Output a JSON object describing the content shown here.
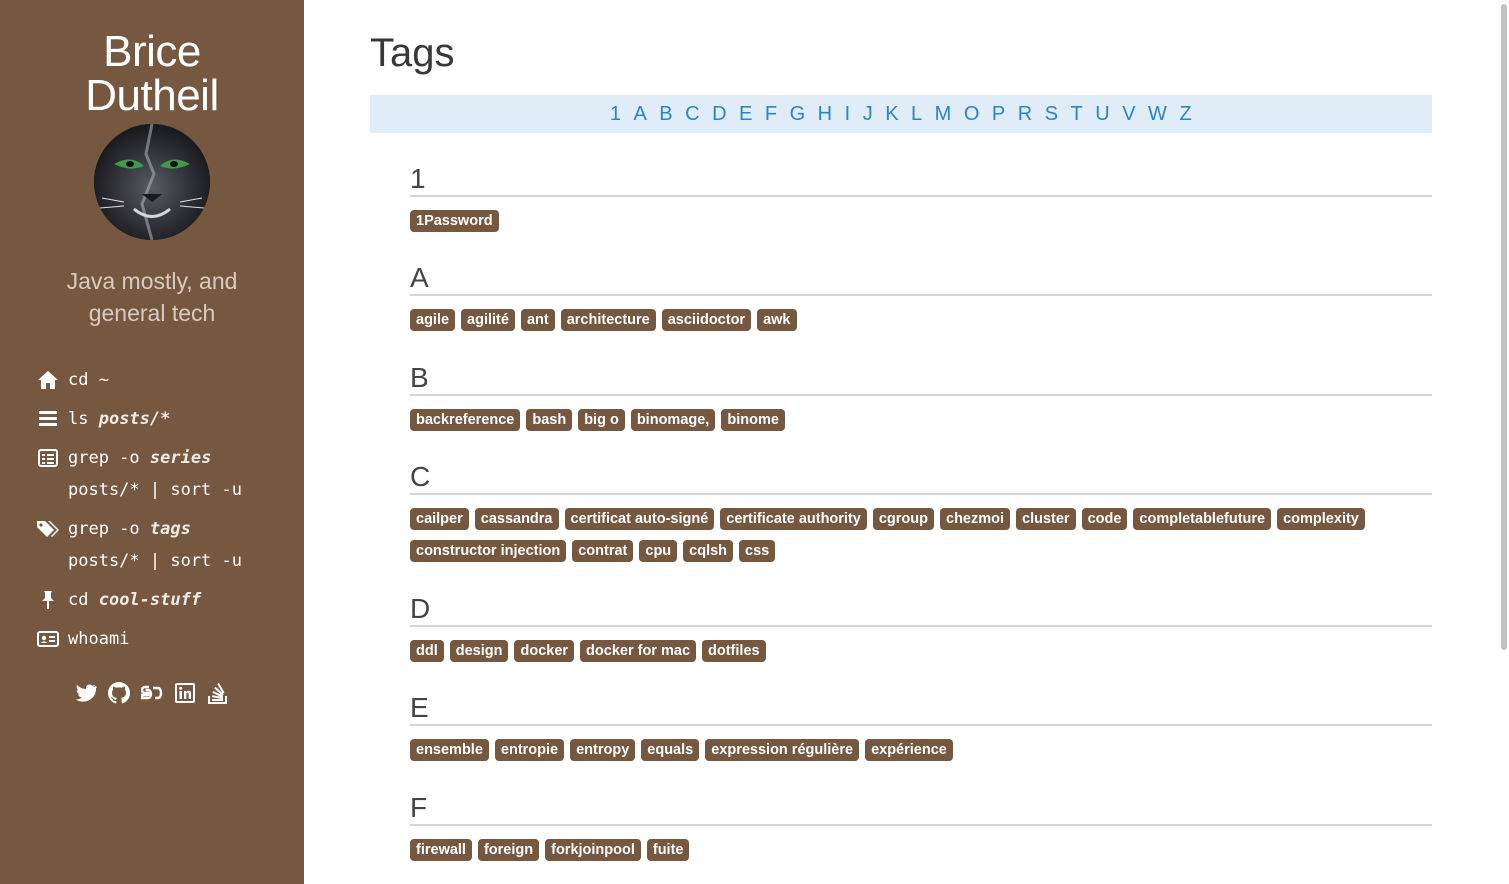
{
  "sidebar": {
    "title_line1": "Brice",
    "title_line2": "Dutheil",
    "tagline": "Java mostly, and general tech",
    "nav": [
      {
        "icon": "home-icon",
        "cmd": "cd ~ ",
        "arg": ""
      },
      {
        "icon": "list-icon",
        "cmd": "ls ",
        "arg": "posts/*"
      },
      {
        "icon": "list-alt-icon",
        "cmd": "grep -o ",
        "arg": "series",
        "line2": "posts/* | sort -u"
      },
      {
        "icon": "tags-icon",
        "cmd": "grep -o ",
        "arg": "tags",
        "line2": "posts/* | sort -u"
      },
      {
        "icon": "pin-icon",
        "cmd": "cd ",
        "arg": "cool-stuff"
      },
      {
        "icon": "id-card-icon",
        "cmd": "whoami",
        "arg": ""
      }
    ],
    "social": [
      "twitter-icon",
      "github-icon",
      "speakerdeck-icon",
      "linkedin-icon",
      "stackoverflow-icon"
    ]
  },
  "main": {
    "title": "Tags",
    "letters": [
      "1",
      "A",
      "B",
      "C",
      "D",
      "E",
      "F",
      "G",
      "H",
      "I",
      "J",
      "K",
      "L",
      "M",
      "O",
      "P",
      "R",
      "S",
      "T",
      "U",
      "V",
      "W",
      "Z"
    ],
    "sections": [
      {
        "letter": "1",
        "tags": [
          "1Password"
        ]
      },
      {
        "letter": "A",
        "tags": [
          "agile",
          "agilité",
          "ant",
          "architecture",
          "asciidoctor",
          "awk"
        ]
      },
      {
        "letter": "B",
        "tags": [
          "backreference",
          "bash",
          "big o",
          "binomage,",
          "binome"
        ]
      },
      {
        "letter": "C",
        "tags": [
          "cailper",
          "cassandra",
          "certificat auto-signé",
          "certificate authority",
          "cgroup",
          "chezmoi",
          "cluster",
          "code",
          "completablefuture",
          "complexity",
          "constructor injection",
          "contrat",
          "cpu",
          "cqlsh",
          "css"
        ]
      },
      {
        "letter": "D",
        "tags": [
          "ddl",
          "design",
          "docker",
          "docker for mac",
          "dotfiles"
        ]
      },
      {
        "letter": "E",
        "tags": [
          "ensemble",
          "entropie",
          "entropy",
          "equals",
          "expression régulière",
          "expérience"
        ]
      },
      {
        "letter": "F",
        "tags": [
          "firewall",
          "foreign",
          "forkjoinpool",
          "fuite"
        ]
      }
    ]
  },
  "colors": {
    "sidebar_bg": "#765740",
    "tag_bg": "#765740",
    "alpha_bar_bg": "#e1ecf9",
    "link": "#2a84c6"
  }
}
